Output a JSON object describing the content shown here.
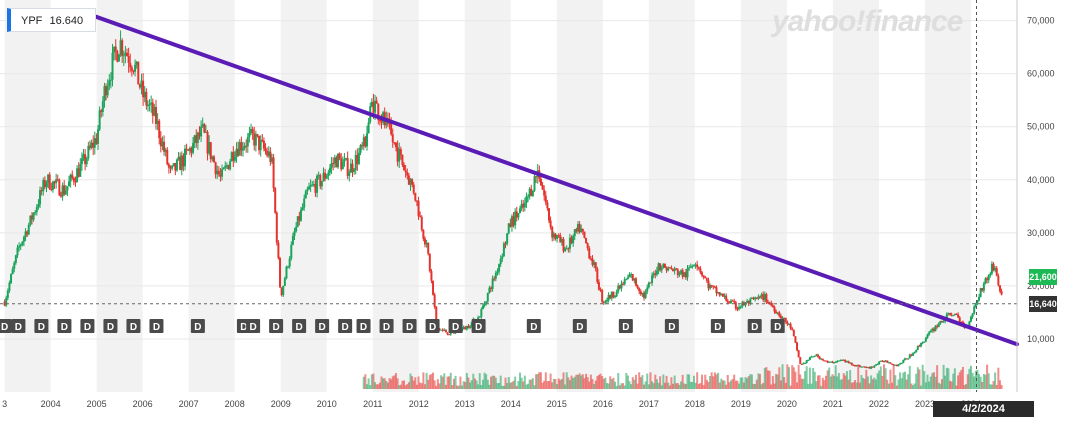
{
  "ticker": {
    "symbol": "YPF",
    "price": "16.640"
  },
  "brand": "yahoo!finance",
  "badges": {
    "last_price": "16,640",
    "last_price_color": "#333333",
    "current_price": "21,600",
    "current_price_color": "#1db954"
  },
  "crosshair_date": "4/2/2024",
  "dividend_marker": "D",
  "colors": {
    "up": "#1ba35b",
    "down": "#e5322d",
    "trendline": "#5a1cb5",
    "band": "#f2f2f2"
  },
  "chart_data": {
    "type": "candlestick",
    "title": "",
    "xlabel": "",
    "ylabel": "",
    "x_ticks": [
      "3",
      "2004",
      "2005",
      "2006",
      "2007",
      "2008",
      "2009",
      "2010",
      "2011",
      "2012",
      "2013",
      "2014",
      "2015",
      "2016",
      "2017",
      "2018",
      "2019",
      "2020",
      "2021",
      "2022",
      "2023",
      "2024"
    ],
    "y_ticks": [
      10000,
      20000,
      30000,
      40000,
      50000,
      60000,
      70000
    ],
    "y_tick_labels": [
      "10,000",
      "20,000",
      "30,000",
      "40,000",
      "50,000",
      "60,000",
      "70,000"
    ],
    "ylim": [
      0,
      72000
    ],
    "x_range": [
      2002.9,
      2025.0
    ],
    "series": [
      {
        "x": [
          2003.0,
          2003.3,
          2003.6,
          2003.9,
          2004.3,
          2004.7,
          2005.0,
          2005.2,
          2005.5,
          2005.8,
          2006.0,
          2006.3,
          2006.6,
          2006.9,
          2007.3,
          2007.7,
          2008.0,
          2008.4,
          2008.8,
          2009.0,
          2009.3,
          2009.6,
          2009.9,
          2010.2,
          2010.5,
          2010.8,
          2011.0,
          2011.3,
          2011.6,
          2011.9,
          2012.2,
          2012.4,
          2012.7,
          2013.0,
          2013.3,
          2013.7,
          2014.0,
          2014.3,
          2014.6,
          2014.9,
          2015.2,
          2015.5,
          2015.8,
          2016.0,
          2016.3,
          2016.6,
          2016.9,
          2017.2,
          2017.5,
          2017.8,
          2018.0,
          2018.3,
          2018.6,
          2018.9,
          2019.2,
          2019.5,
          2019.8,
          2020.1,
          2020.3,
          2020.6,
          2020.9,
          2021.2,
          2021.5,
          2021.8,
          2022.1,
          2022.4,
          2022.7,
          2023.0,
          2023.3,
          2023.6,
          2023.9,
          2024.2,
          2024.5,
          2024.7
        ],
        "values": [
          17000,
          27000,
          33000,
          40000,
          38000,
          43000,
          48000,
          58000,
          66000,
          62000,
          56000,
          51000,
          41000,
          44000,
          49000,
          40000,
          46000,
          48000,
          44000,
          18000,
          30000,
          38000,
          40000,
          44000,
          42000,
          46000,
          55000,
          50000,
          44000,
          38000,
          26000,
          12000,
          11000,
          12000,
          14000,
          23000,
          32000,
          35000,
          42000,
          30000,
          27000,
          31000,
          24000,
          17000,
          19000,
          22000,
          18000,
          24000,
          23000,
          22000,
          25000,
          20000,
          18000,
          16000,
          17000,
          18000,
          15000,
          12000,
          5000,
          7000,
          5500,
          6000,
          5000,
          4500,
          6000,
          5000,
          7000,
          10000,
          13000,
          15000,
          12000,
          19000,
          24000,
          16640
        ]
      }
    ],
    "trendline": {
      "start": [
        2004.9,
        71000
      ],
      "end": [
        2025.0,
        9000
      ]
    },
    "current_price": 21600,
    "last_price": 16640,
    "dividend_years": [
      2003.0,
      2003.3,
      2003.8,
      2004.3,
      2004.8,
      2005.3,
      2005.8,
      2006.3,
      2007.2,
      2008.2,
      2008.4,
      2008.9,
      2009.4,
      2009.9,
      2010.4,
      2010.8,
      2011.3,
      2011.8,
      2012.3,
      2012.8,
      2013.3,
      2014.5,
      2015.5,
      2016.5,
      2017.5,
      2018.5,
      2019.3,
      2019.8
    ]
  }
}
